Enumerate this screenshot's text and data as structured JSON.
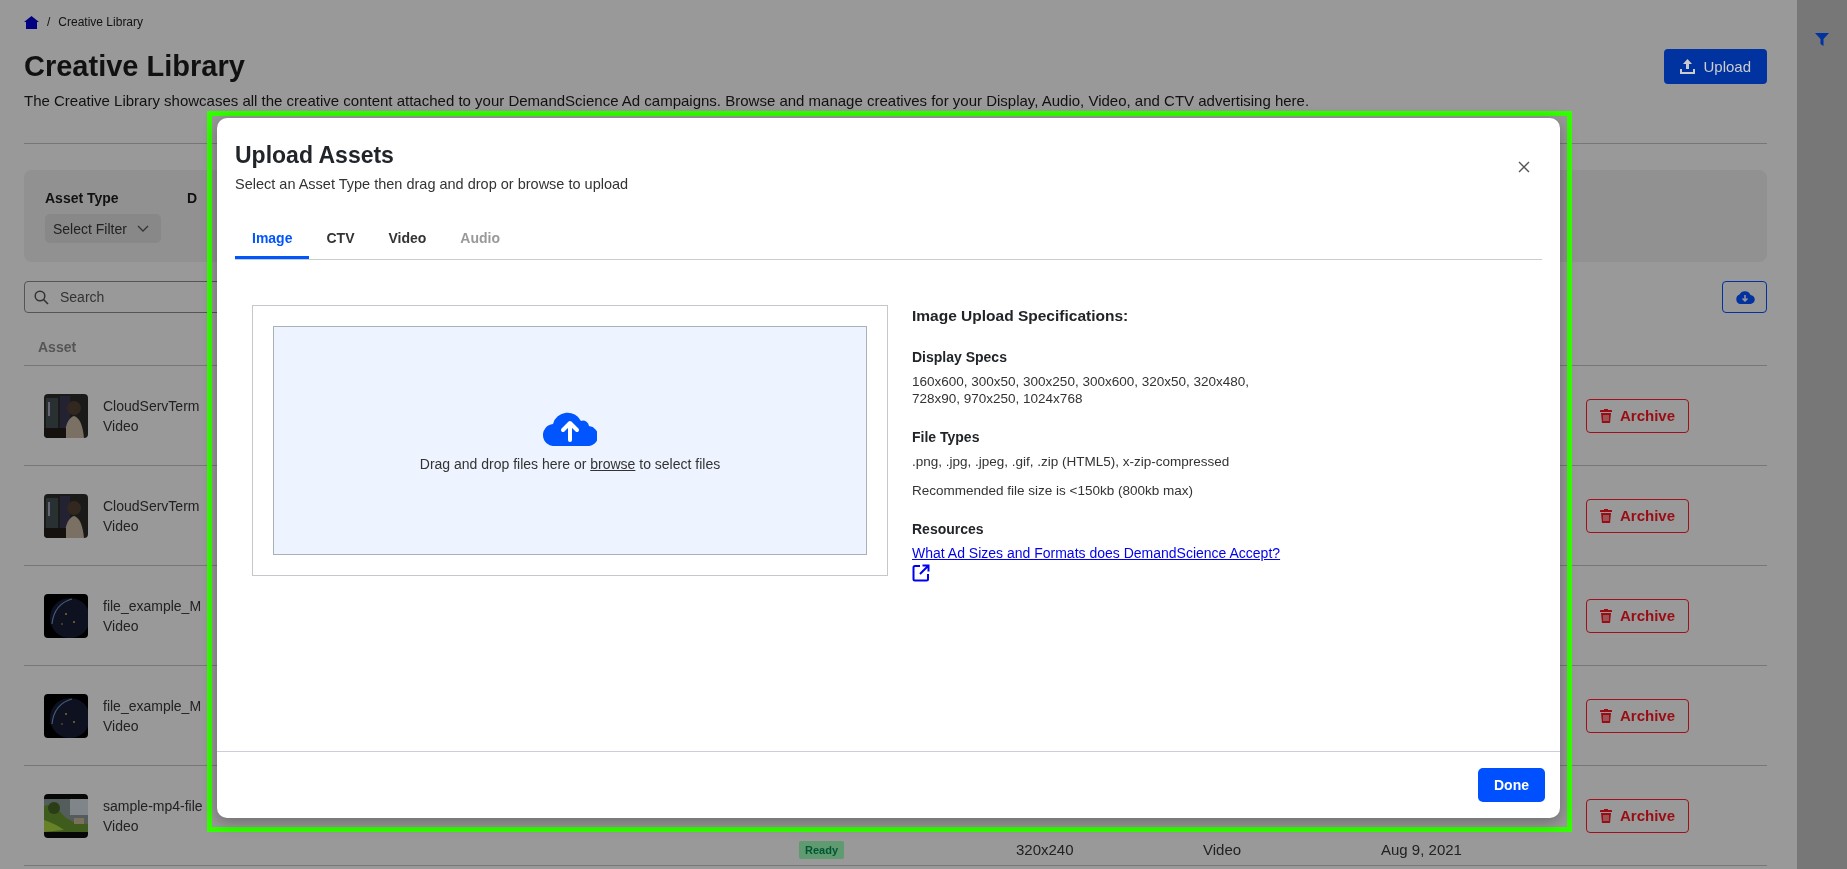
{
  "breadcrumb": {
    "separator": "/",
    "current": "Creative Library"
  },
  "header": {
    "title": "Creative Library",
    "upload_button": "Upload",
    "description": "The Creative Library showcases all the creative content attached to your DemandScience Ad campaigns. Browse and manage creatives for your Display, Audio, Video, and CTV advertising here."
  },
  "filters": [
    {
      "label": "Asset Type",
      "value": "Select Filter"
    },
    {
      "label": "D"
    }
  ],
  "search": {
    "placeholder": "Search"
  },
  "table": {
    "columns": [
      "Asset"
    ],
    "rows": [
      {
        "name": "CloudServTerm",
        "type": "Video",
        "action": "Archive"
      },
      {
        "name": "CloudServTerm",
        "type": "Video",
        "action": "Archive"
      },
      {
        "name": "file_example_M",
        "type": "Video",
        "action": "Archive"
      },
      {
        "name": "file_example_M",
        "type": "Video",
        "action": "Archive"
      },
      {
        "name": "sample-mp4-file",
        "type": "Video",
        "status": "Ready",
        "size": "320x240",
        "asset_type": "Video",
        "date": "Aug 9, 2021",
        "action": "Archive"
      }
    ]
  },
  "modal": {
    "title": "Upload Assets",
    "subtitle": "Select an Asset Type then drag and drop or browse to upload",
    "tabs": [
      {
        "label": "Image",
        "selected": true,
        "disabled": false
      },
      {
        "label": "CTV",
        "selected": false,
        "disabled": false
      },
      {
        "label": "Video",
        "selected": false,
        "disabled": false
      },
      {
        "label": "Audio",
        "selected": false,
        "disabled": true
      }
    ],
    "dropzone": {
      "before": "Drag and drop files here or ",
      "link": "browse",
      "after": " to select files"
    },
    "specs": {
      "heading": "Image Upload Specifications:",
      "sections": [
        {
          "title": "Display Specs",
          "lines": [
            "160x600, 300x50, 300x250, 300x600, 320x50, 320x480,",
            "728x90, 970x250, 1024x768"
          ]
        },
        {
          "title": "File Types",
          "paragraphs": [
            ".png, .jpg, .jpeg, .gif, .zip (HTML5), x-zip-compressed",
            "Recommended file size is <150kb (800kb max)"
          ]
        },
        {
          "title": "Resources",
          "link": "What Ad Sizes and Formats does DemandScience Accept?"
        }
      ]
    },
    "done_button": "Done"
  }
}
